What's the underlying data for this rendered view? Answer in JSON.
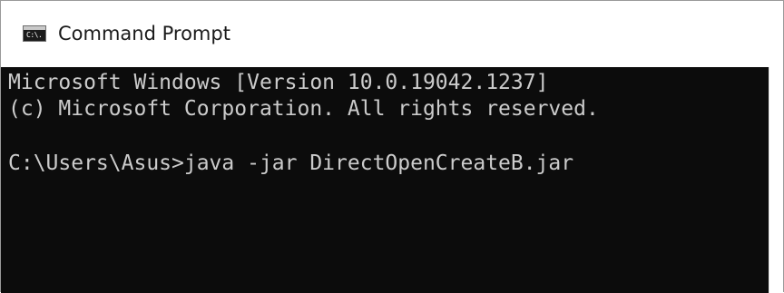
{
  "window": {
    "title": "Command Prompt",
    "icon": "cmd-icon",
    "icon_text": "C:\\."
  },
  "console": {
    "lines": [
      "Microsoft Windows [Version 10.0.19042.1237]",
      "(c) Microsoft Corporation. All rights reserved.",
      "C:\\Users\\Asus>java -jar DirectOpenCreateB.jar"
    ]
  },
  "colors": {
    "console_background": "#0c0c0c",
    "console_text": "#cccccc",
    "titlebar_background": "#ffffff",
    "title_text": "#1a1a1a"
  }
}
